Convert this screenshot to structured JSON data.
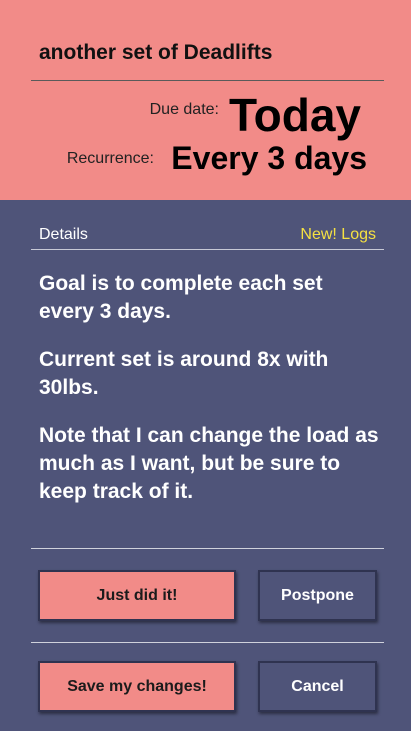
{
  "task": {
    "title": "another set of Deadlifts",
    "due_label": "Due date:",
    "due_value": "Today",
    "recurrence_label": "Recurrence:",
    "recurrence_value": "Every 3 days"
  },
  "details": {
    "label": "Details",
    "logs_link": "New! Logs",
    "paragraphs": [
      "Goal is to complete each set every 3 days.",
      "Current set is around 8x with 30lbs.",
      "Note that I can change the load as much as I want, but be sure to keep track of it."
    ]
  },
  "actions": {
    "done_label": "Just did it!",
    "postpone_label": "Postpone",
    "save_label": "Save my changes!",
    "cancel_label": "Cancel"
  },
  "colors": {
    "header_bg": "#f28b88",
    "body_bg": "#4f5479",
    "link": "#f5e142"
  }
}
